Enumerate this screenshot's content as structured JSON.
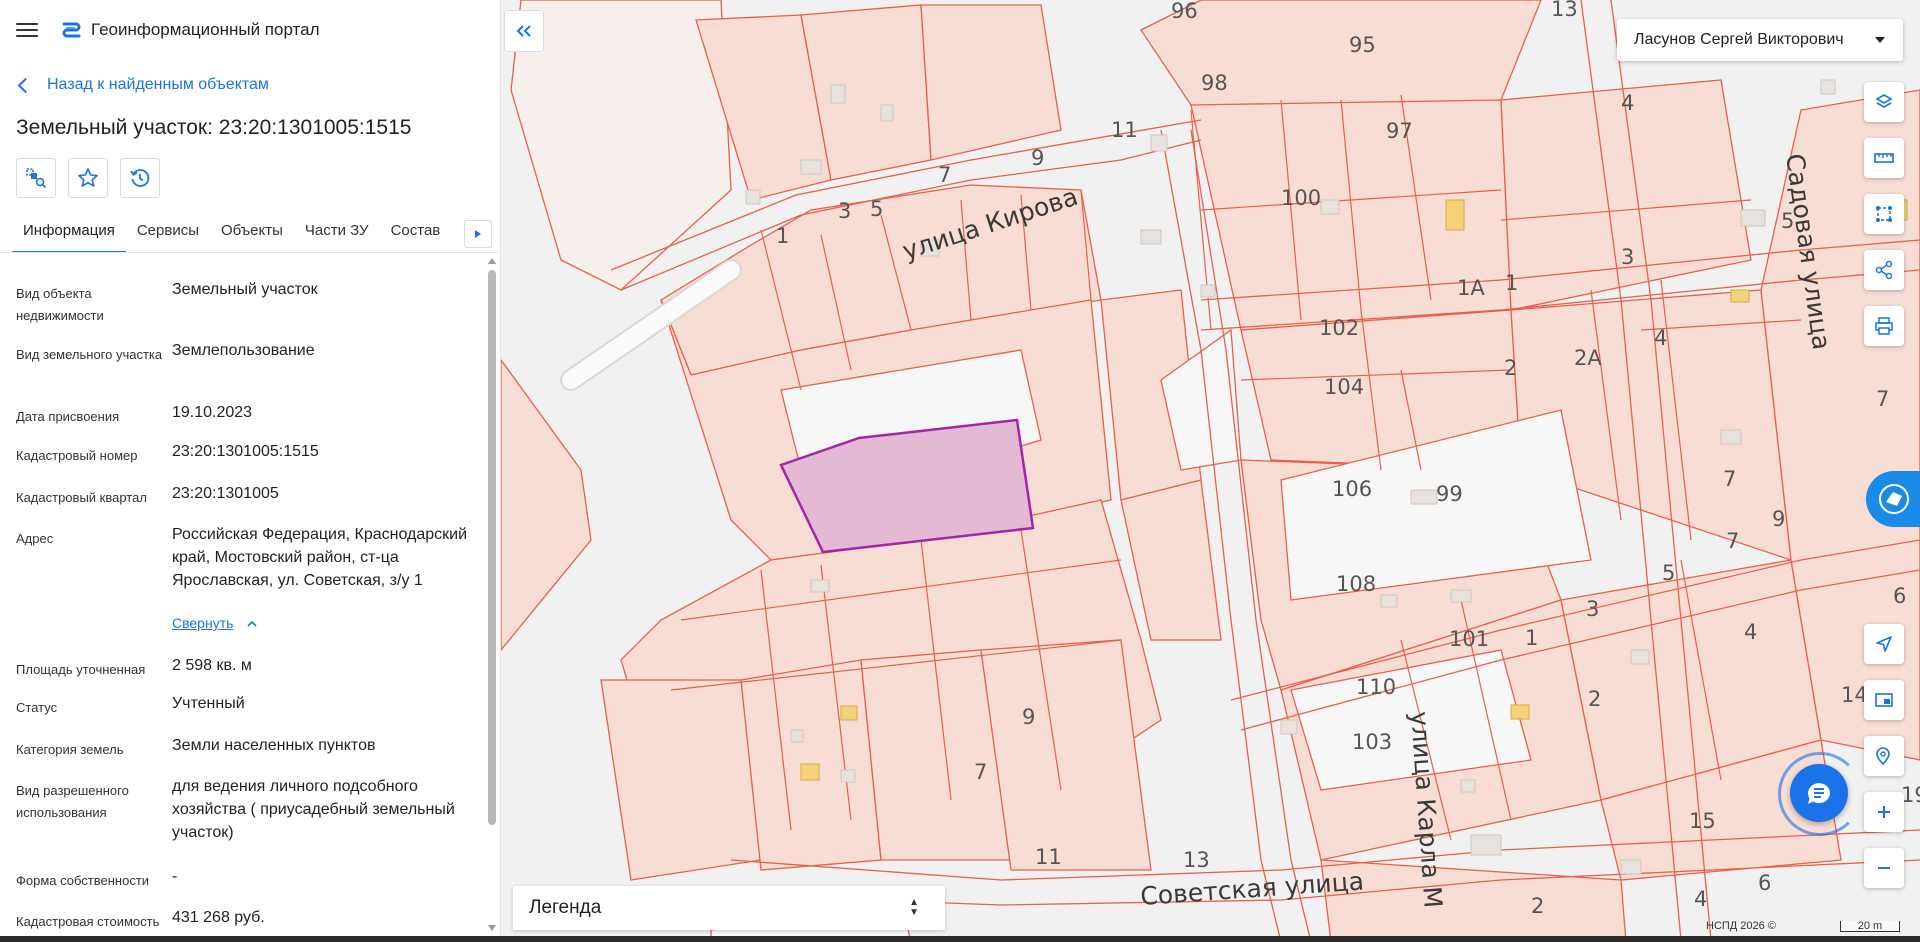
{
  "app": {
    "title": "Геоинформационный портал"
  },
  "nav": {
    "back_label": "Назад к найденным объектам"
  },
  "object": {
    "title": "Земельный участок: 23:20:1301005:1515"
  },
  "tabs": [
    {
      "label": "Информация",
      "active": true
    },
    {
      "label": "Сервисы"
    },
    {
      "label": "Объекты"
    },
    {
      "label": "Части ЗУ"
    },
    {
      "label": "Состав"
    }
  ],
  "properties": [
    {
      "key": "Вид объекта недвижимости",
      "value": "Земельный участок"
    },
    {
      "key": "Вид земельного участка",
      "value": "Землепользование"
    },
    {
      "key": "Дата присвоения",
      "value": "19.10.2023"
    },
    {
      "key": "Кадастровый номер",
      "value": "23:20:1301005:1515"
    },
    {
      "key": "Кадастровый квартал",
      "value": "23:20:1301005"
    },
    {
      "key": "Адрес",
      "value": "Российская Федерация, Краснодарский край, Мостовский район, ст-ца Ярославская, ул. Советская, з/у 1"
    },
    {
      "key": "Площадь уточненная",
      "value": "2 598 кв. м"
    },
    {
      "key": "Статус",
      "value": "Учтенный"
    },
    {
      "key": "Категория земель",
      "value": "Земли населенных пунктов"
    },
    {
      "key": "Вид разрешенного использования",
      "value": "для ведения личного подсобного хозяйства ( приусадебный земельный участок)"
    },
    {
      "key": "Форма собственности",
      "value": "-"
    },
    {
      "key": "Кадастровая стоимость",
      "value": "431 268 руб."
    }
  ],
  "address_collapse_label": "Свернуть",
  "user": {
    "name": "Ласунов Сергей Викторович"
  },
  "legend": {
    "label": "Легенда"
  },
  "map": {
    "copyright": "НСПД 2026 ©",
    "scale_label": "20 m",
    "streets": [
      "улица Кирова",
      "Садовая улица",
      "Советская улица",
      "улица Карла М"
    ],
    "house_numbers": [
      "96",
      "13",
      "95",
      "98",
      "11",
      "9",
      "7",
      "3",
      "5",
      "1",
      "97",
      "4",
      "100",
      "5",
      "7",
      "1А",
      "1",
      "3",
      "102",
      "2",
      "2А",
      "4",
      "104",
      "7",
      "106",
      "99",
      "7",
      "9",
      "5",
      "108",
      "3",
      "101",
      "1",
      "6",
      "4",
      "9",
      "2",
      "110",
      "14",
      "103",
      "7",
      "15",
      "11",
      "13",
      "6",
      "2",
      "4",
      "19"
    ]
  },
  "colors": {
    "accent": "#1a73e8",
    "parcel_fill": "#f8ddd5",
    "parcel_stroke": "#e8604a",
    "selected_fill": "#e4b9d4",
    "selected_stroke": "#a325a8"
  }
}
